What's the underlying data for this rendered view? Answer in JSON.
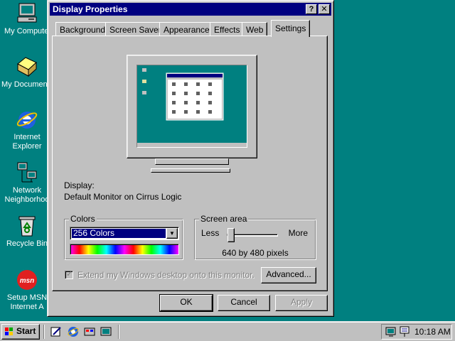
{
  "desktop": {
    "icons": [
      {
        "label": "My Compute"
      },
      {
        "label": "My Documen"
      },
      {
        "label": "Internet\nExplorer"
      },
      {
        "label": "Network\nNeighborhoo"
      },
      {
        "label": "Recycle Bin"
      },
      {
        "label": "Setup MSN\nInternet A"
      }
    ]
  },
  "window": {
    "title": "Display Properties",
    "help_btn": "?",
    "close_btn": "✕",
    "tabs": [
      "Background",
      "Screen Saver",
      "Appearance",
      "Effects",
      "Web",
      "Settings"
    ],
    "active_tab": "Settings",
    "display_label": "Display:",
    "display_value": "Default Monitor on Cirrus Logic",
    "colors": {
      "group_label": "Colors",
      "selected": "256 Colors"
    },
    "screen_area": {
      "group_label": "Screen area",
      "less_label": "Less",
      "more_label": "More",
      "resolution": "640 by 480 pixels",
      "slider_level": 0
    },
    "extend_checkbox_label": "Extend my Windows desktop onto this monitor.",
    "advanced_button": "Advanced...",
    "ok_button": "OK",
    "cancel_button": "Cancel",
    "apply_button": "Apply"
  },
  "taskbar": {
    "start_label": "Start",
    "clock": "10:18 AM"
  },
  "colors": {
    "desktop": "#008080",
    "titlebar": "#000080",
    "face": "#c0c0c0"
  }
}
